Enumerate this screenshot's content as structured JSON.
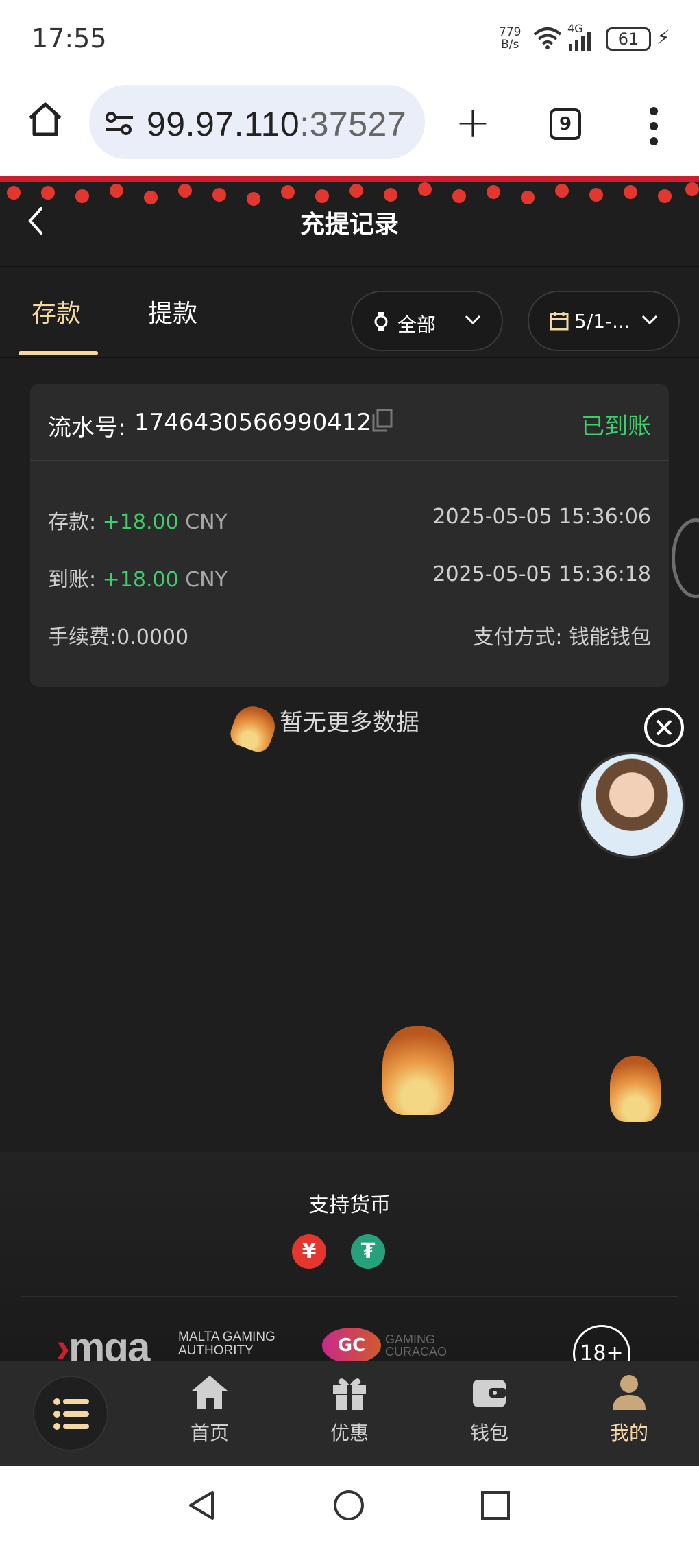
{
  "status_bar": {
    "time": "17:55",
    "net_speed_value": "779",
    "net_speed_unit": "B/s",
    "network": "4G",
    "battery": "61"
  },
  "browser": {
    "url_host": "99.97.110",
    "url_port": ":37527",
    "tab_count": "9"
  },
  "header": {
    "title": "充提记录"
  },
  "tabs": [
    {
      "label": "存款",
      "active": true
    },
    {
      "label": "提款",
      "active": false
    }
  ],
  "filters": {
    "status": "全部",
    "date": "5/1-..."
  },
  "record": {
    "serial_label": "流水号:",
    "serial": "1746430566990412",
    "status": "已到账",
    "deposit_label": "存款:",
    "deposit_amount": "+18.00",
    "currency": "CNY",
    "deposit_time": "2025-05-05 15:36:06",
    "credited_label": "到账:",
    "credited_amount": "+18.00",
    "credited_time": "2025-05-05 15:36:18",
    "fee": "手续费:0.0000",
    "payment_method": "支付方式: 钱能钱包"
  },
  "no_more": "暂无更多数据",
  "currency_section": {
    "title": "支持货币",
    "cny_symbol": "¥",
    "usdt_symbol": "₮"
  },
  "licenses": {
    "mga_logo": "mga",
    "mga_line1": "MALTA GAMING",
    "mga_line2": "AUTHORITY",
    "gc_logo": "GC",
    "gc_line1": "GAMING",
    "gc_line2": "CURACAO",
    "age": "18+"
  },
  "bottom_nav": [
    {
      "label": "首页",
      "icon": "home-icon"
    },
    {
      "label": "优惠",
      "icon": "gift-icon"
    },
    {
      "label": "钱包",
      "icon": "wallet-icon"
    },
    {
      "label": "我的",
      "icon": "user-icon",
      "active": true
    }
  ],
  "colors": {
    "accent": "#f3d8a6",
    "success": "#3fce6c",
    "background": "#1e1e1e",
    "card": "#2b2b2b"
  }
}
